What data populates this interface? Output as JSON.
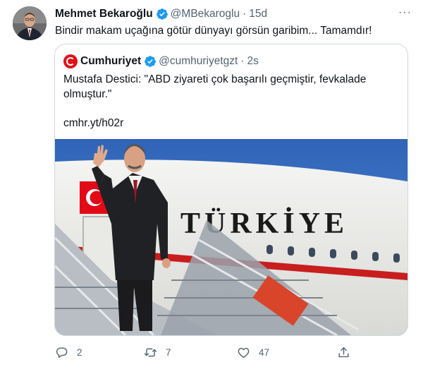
{
  "tweet": {
    "author_name": "Mehmet Bekaroğlu",
    "handle": "@MBekaroglu",
    "separator": "·",
    "time": "15d",
    "more": "···",
    "text": "Bindir makam uçağına götür dünyayı görsün garibim... Tamamdır!"
  },
  "quoted": {
    "author_name": "Cumhuriyet",
    "handle": "@cumhuriyetgzt",
    "separator": "·",
    "time": "2s",
    "text": "Mustafa Destici: \"ABD ziyareti çok başarılı geçmiştir, fevkalade olmuştur.\"\n\ncmhr.yt/h02r",
    "image": {
      "plane_text": "TÜRKİYE"
    }
  },
  "actions": {
    "reply_count": "2",
    "retweet_count": "7",
    "like_count": "47"
  },
  "colors": {
    "verified": "#1d9bf0",
    "muted": "#536471",
    "cumhuriyet_red": "#e0131a"
  }
}
